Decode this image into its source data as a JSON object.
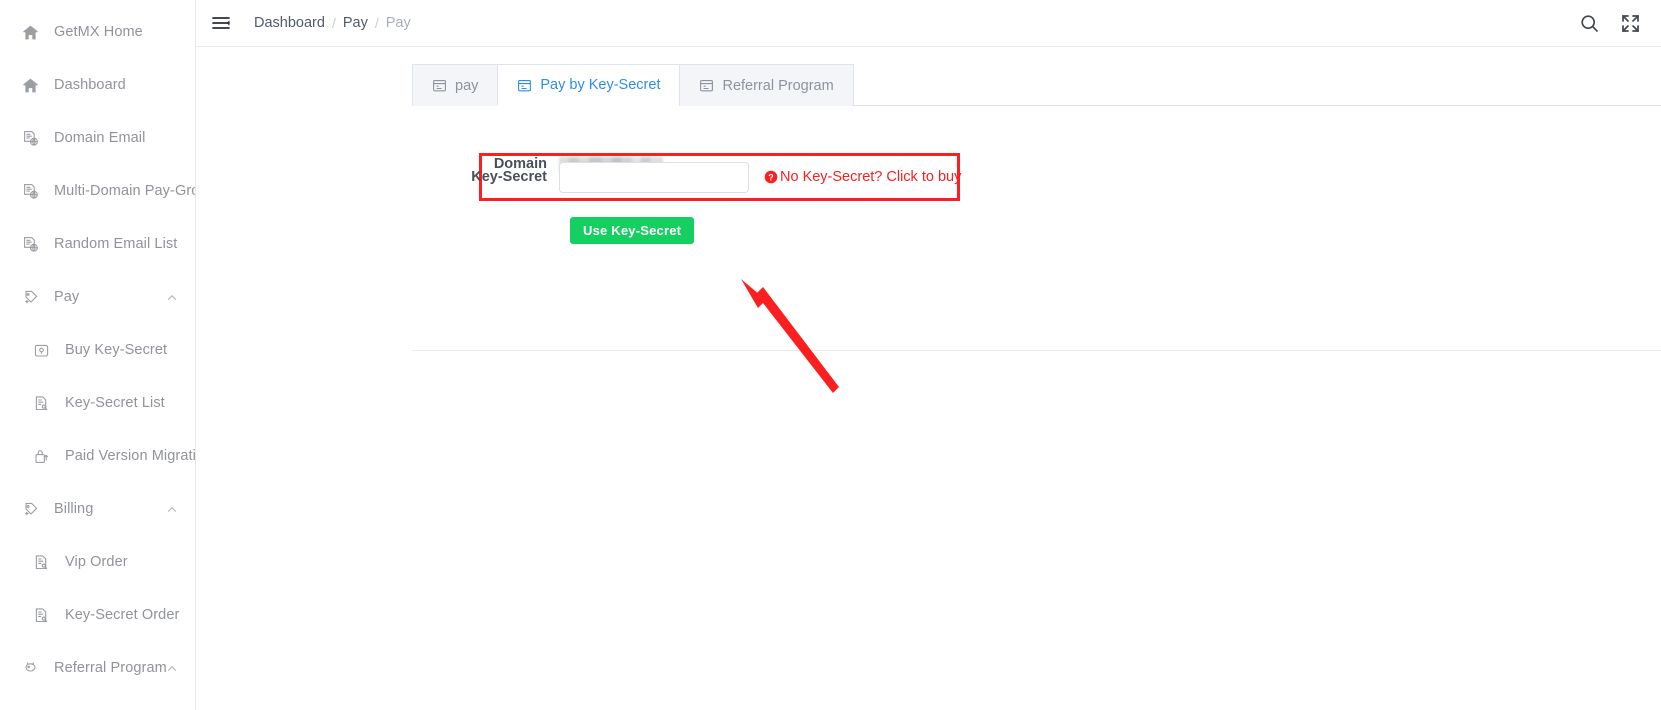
{
  "sidebar": {
    "items": [
      {
        "label": "GetMX Home",
        "icon": "home-icon",
        "level": "top",
        "expandable": false
      },
      {
        "label": "Dashboard",
        "icon": "home-icon",
        "level": "top",
        "expandable": false
      },
      {
        "label": "Domain Email",
        "icon": "domain-email-icon",
        "level": "top",
        "expandable": false
      },
      {
        "label": "Multi-Domain Pay-Group",
        "icon": "domain-email-icon",
        "level": "top",
        "expandable": false
      },
      {
        "label": "Random Email List",
        "icon": "domain-email-icon",
        "level": "top",
        "expandable": false
      },
      {
        "label": "Pay",
        "icon": "pay-tag-icon",
        "level": "top",
        "expandable": true
      },
      {
        "label": "Buy Key-Secret",
        "icon": "key-box-icon",
        "level": "sub",
        "expandable": false
      },
      {
        "label": "Key-Secret List",
        "icon": "doc-key-icon",
        "level": "sub",
        "expandable": false
      },
      {
        "label": "Paid Version Migration",
        "icon": "upgrade-lock-icon",
        "level": "sub",
        "expandable": false
      },
      {
        "label": "Billing",
        "icon": "pay-tag-icon",
        "level": "top",
        "expandable": true
      },
      {
        "label": "Vip Order",
        "icon": "doc-key-icon",
        "level": "sub",
        "expandable": false
      },
      {
        "label": "Key-Secret Order",
        "icon": "doc-key-icon",
        "level": "sub",
        "expandable": false
      },
      {
        "label": "Referral Program",
        "icon": "gift-icon",
        "level": "top",
        "expandable": true
      }
    ]
  },
  "header": {
    "menu_toggle_icon": "hamburger-icon",
    "breadcrumb": [
      {
        "label": "Dashboard",
        "active": false
      },
      {
        "label": "Pay",
        "active": false
      },
      {
        "label": "Pay",
        "active": true
      }
    ],
    "separator": "/",
    "actions": [
      {
        "name": "search-icon",
        "label": "Search"
      },
      {
        "name": "fullscreen-icon",
        "label": "Fullscreen"
      }
    ]
  },
  "tabs": [
    {
      "label": "pay",
      "icon": "calendar-icon",
      "active": false
    },
    {
      "label": "Pay by Key-Secret",
      "icon": "calendar-icon",
      "active": true
    },
    {
      "label": "Referral Program",
      "icon": "calendar-icon",
      "active": false
    }
  ],
  "form": {
    "domain": {
      "label": "Domain",
      "value": "",
      "redacted": true
    },
    "key_secret": {
      "label": "Key-Secret",
      "value": "",
      "placeholder": ""
    },
    "buy_link": {
      "text": "No Key-Secret? Click to buy",
      "icon": "question-circle-icon",
      "color": "#fb1f1f"
    },
    "submit": {
      "label": "Use Key-Secret",
      "color": "#16cf61"
    },
    "highlight": {
      "color": "#fb1f1f",
      "target": "key-secret-field"
    }
  },
  "annotation": {
    "type": "arrow",
    "color": "#fb1f1f",
    "points_to": "key-secret-input"
  },
  "colors": {
    "accent_blue": "#2d8cf0",
    "sidebar_text": "#909399",
    "breadcrumb_text": "#515a6e",
    "alert_red": "#fb1f1f",
    "success_green": "#16cf61"
  }
}
